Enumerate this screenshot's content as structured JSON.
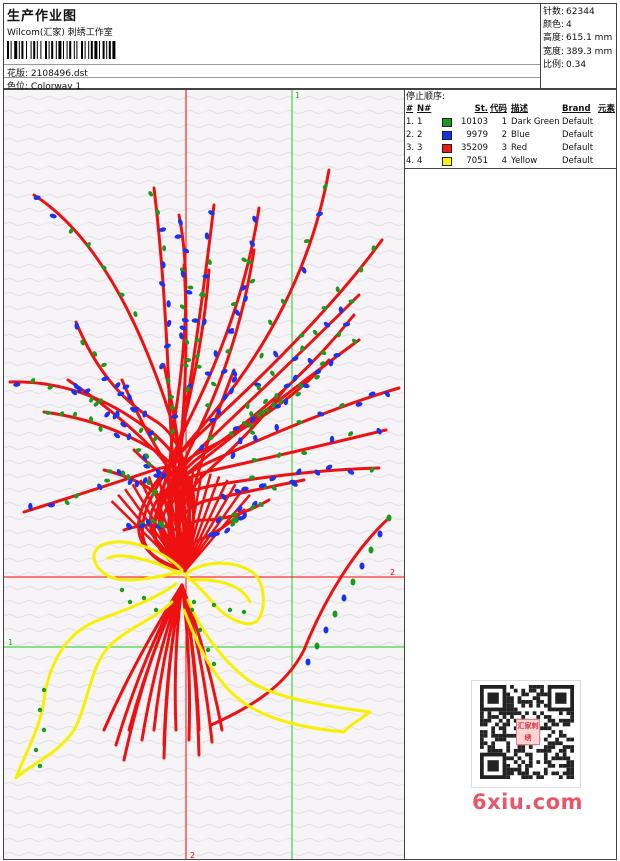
{
  "header": {
    "title": "生产作业图",
    "company": "Wilcom(汇家) 刺绣工作室",
    "design_label": "花版:",
    "design_value": "2108496.dst",
    "colorway_label": "色位:",
    "colorway_value": "Colorway 1"
  },
  "stats": [
    {
      "label": "针数:",
      "value": "62344"
    },
    {
      "label": "颜色:",
      "value": "4"
    },
    {
      "label": "高度:",
      "value": "615.1 mm"
    },
    {
      "label": "宽度:",
      "value": "389.3 mm"
    },
    {
      "label": "比例:",
      "value": "0.34"
    }
  ],
  "stop_sequence": {
    "title": "停止顺序:",
    "columns": {
      "idx": "#",
      "no": "N#",
      "stitches": "St.",
      "code": "代码",
      "description": "描述",
      "brand": "Brand",
      "element": "元素"
    },
    "rows": [
      {
        "idx": "1.",
        "no": "1",
        "color": "#1a9a1a",
        "stitches": "10103",
        "code": "1",
        "description": "Dark Green",
        "brand": "Default"
      },
      {
        "idx": "2.",
        "no": "2",
        "color": "#1133ee",
        "stitches": "9979",
        "code": "2",
        "description": "Blue",
        "brand": "Default"
      },
      {
        "idx": "3.",
        "no": "3",
        "color": "#ee1a1a",
        "stitches": "35209",
        "code": "3",
        "description": "Red",
        "brand": "Default"
      },
      {
        "idx": "4.",
        "no": "4",
        "color": "#f5f500",
        "stitches": "7051",
        "code": "4",
        "description": "Yellow",
        "brand": "Default"
      }
    ]
  },
  "guides": {
    "v1_label": "1",
    "v2_label": "2",
    "h1_label": "1",
    "h2_label": "2"
  },
  "colors": {
    "red": "#ee1111",
    "blue": "#1a33ee",
    "green": "#1c9a1c",
    "yellow": "#f8f000",
    "guide_red": "#ff0000",
    "guide_green": "#22cc22"
  },
  "watermark": "6xiu.com",
  "qr_badge": "汇家刺绣"
}
